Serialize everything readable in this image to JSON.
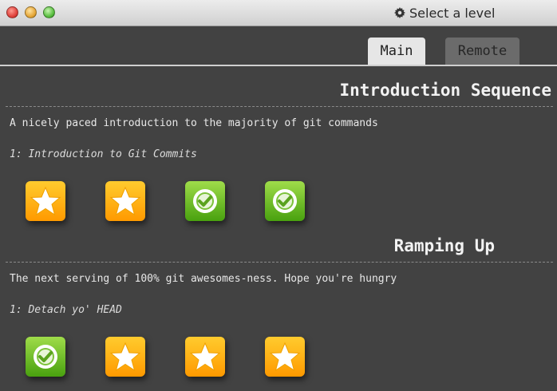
{
  "window": {
    "title": "Select a level",
    "title_icon": "gear-icon"
  },
  "tabs": [
    {
      "label": "Main",
      "active": true
    },
    {
      "label": "Remote",
      "active": false
    }
  ],
  "sections": [
    {
      "title": "Introduction Sequence",
      "about": "A nicely paced introduction to the majority of git commands",
      "selected_level": "1: Introduction to Git Commits",
      "levels": [
        {
          "status": "star-icon"
        },
        {
          "status": "star-icon"
        },
        {
          "status": "check-icon"
        },
        {
          "status": "check-icon"
        }
      ]
    },
    {
      "title": "Ramping Up",
      "about": "The next serving of 100% git awesomes-ness. Hope you're hungry",
      "selected_level": "1: Detach yo' HEAD",
      "levels": [
        {
          "status": "check-icon"
        },
        {
          "status": "star-icon"
        },
        {
          "status": "star-icon"
        },
        {
          "status": "star-icon"
        }
      ]
    }
  ],
  "colors": {
    "background": "#424242",
    "star_tile": "#ffb300",
    "completed_tile": "#5cb31c"
  }
}
